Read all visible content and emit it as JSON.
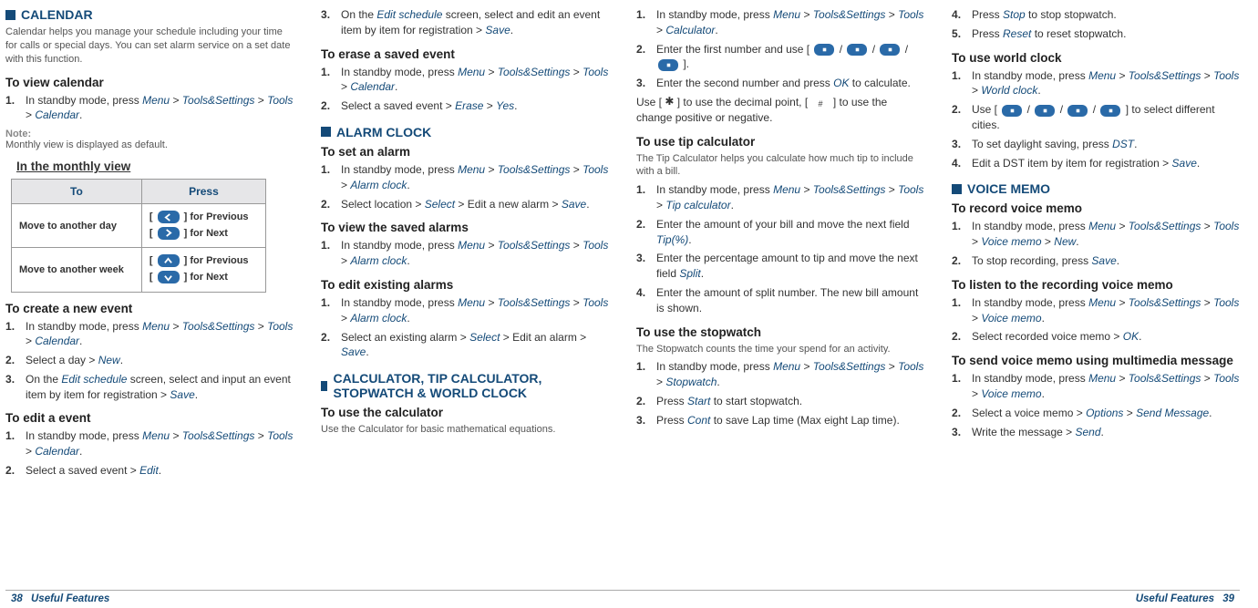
{
  "footer": {
    "leftPage": "38",
    "leftTitle": "Useful Features",
    "rightTitle": "Useful Features",
    "rightPage": "39"
  },
  "col1": {
    "calendar": {
      "title": "CALENDAR",
      "intro": "Calendar helps you manage your schedule including your time for calls or special days. You can set alarm service on a set date with this function.",
      "viewHead": "To view calendar",
      "viewStep": [
        "In standby mode, press ",
        "Menu",
        " > ",
        "Tools&Settings",
        " > ",
        "Tools",
        " > ",
        "Calendar",
        "."
      ],
      "noteLabel": "Note:",
      "noteBody": "Monthly view is displayed as default.",
      "monthlyHead": "In the monthly view",
      "tableHead": {
        "to": "To",
        "press": "Press"
      },
      "tableRows": [
        {
          "to": "Move to another day",
          "prev": " ] for Previous",
          "next": " ] for Next"
        },
        {
          "to": "Move to another week",
          "prev": " ] for Previous",
          "next": " ] for Next"
        }
      ],
      "createHead": "To create a new event",
      "createSteps": [
        [
          "In standby mode, press ",
          "Menu",
          " > ",
          "Tools&Settings",
          " > ",
          "Tools",
          " > ",
          "Calendar",
          "."
        ],
        [
          "Select a day > ",
          "New",
          "."
        ],
        [
          "On the ",
          "Edit schedule",
          " screen, select and input an event item by item for registration > ",
          "Save",
          "."
        ]
      ],
      "editHead": "To edit a event",
      "editSteps": [
        [
          "In standby mode, press ",
          "Menu",
          " > ",
          "Tools&Settings",
          " > ",
          "Tools",
          " > ",
          "Calendar",
          "."
        ],
        [
          "Select a saved event > ",
          "Edit",
          "."
        ]
      ]
    }
  },
  "col2": {
    "editCont": [
      "On the ",
      "Edit schedule",
      " screen, select and edit an event item by item for registration > ",
      "Save",
      "."
    ],
    "eraseHead": "To erase a saved event",
    "eraseSteps": [
      [
        "In standby mode, press ",
        "Menu",
        " > ",
        "Tools&Settings",
        " > ",
        "Tools",
        " > ",
        "Calendar",
        "."
      ],
      [
        "Select a saved event > ",
        "Erase",
        " > ",
        "Yes",
        "."
      ]
    ],
    "alarmTitle": "ALARM CLOCK",
    "setHead": "To set an alarm",
    "setSteps": [
      [
        "In standby mode, press ",
        "Menu",
        " > ",
        "Tools&Settings",
        " > ",
        "Tools",
        " > ",
        "Alarm clock",
        "."
      ],
      [
        "Select location > ",
        "Select",
        " > Edit a new alarm > ",
        "Save",
        "."
      ]
    ],
    "viewSavedHead": "To view the saved alarms",
    "viewSavedSteps": [
      [
        "In standby mode, press ",
        "Menu",
        " > ",
        "Tools&Settings",
        " > ",
        "Tools",
        " > ",
        "Alarm clock",
        "."
      ]
    ],
    "editExistHead": "To edit existing alarms",
    "editExistSteps": [
      [
        "In standby mode, press ",
        "Menu",
        " > ",
        "Tools&Settings",
        " > ",
        "Tools",
        " > ",
        "Alarm clock",
        "."
      ],
      [
        "Select an existing alarm > ",
        "Select",
        " > Edit an alarm > ",
        "Save",
        "."
      ]
    ],
    "calcTitle": "CALCULATOR, TIP CALCULATOR, STOPWATCH & WORLD CLOCK",
    "calcHead": "To use the calculator",
    "calcIntro": "Use the Calculator for basic mathematical equations."
  },
  "col3": {
    "calcSteps": [
      [
        "In standby mode, press ",
        "Menu",
        " > ",
        "Tools&Settings",
        " > ",
        "Tools",
        " > ",
        "Calculator",
        "."
      ],
      [
        "Enter the first number and use [ ",
        "ICON",
        " / ",
        "ICON",
        " / ",
        "ICON",
        " / ",
        "ICON",
        " ]."
      ],
      [
        "Enter the second number and press ",
        "OK",
        " to calculate."
      ]
    ],
    "useNote": [
      "Use [ ",
      "*",
      " ] to use the decimal point, [ ",
      "#",
      " ] to use the change positive or negative."
    ],
    "tipHead": "To use tip calculator",
    "tipIntro": "The Tip Calculator helps you calculate how much tip to include with a bill.",
    "tipSteps": [
      [
        "In standby mode, press ",
        "Menu",
        " > ",
        "Tools&Settings",
        " > ",
        "Tools",
        " > ",
        "Tip calculator",
        "."
      ],
      [
        "Enter the amount of your bill and move the next field ",
        "Tip(%)",
        "."
      ],
      [
        "Enter the percentage amount to tip and move the next field ",
        "Split",
        "."
      ],
      [
        "Enter the amount of split number. The new bill amount is shown."
      ]
    ],
    "stopHead": "To use the stopwatch",
    "stopIntro": "The Stopwatch counts the time your spend for an activity.",
    "stopSteps": [
      [
        "In standby mode, press ",
        "Menu",
        " > ",
        "Tools&Settings",
        " > ",
        "Tools",
        " > ",
        "Stopwatch",
        "."
      ],
      [
        "Press ",
        "Start",
        " to start stopwatch."
      ],
      [
        "Press ",
        "Cont",
        " to save Lap time (Max eight Lap time)."
      ]
    ]
  },
  "col4": {
    "stopCont": [
      [
        "Press ",
        "Stop",
        " to stop stopwatch."
      ],
      [
        "Press ",
        "Reset",
        " to reset stopwatch."
      ]
    ],
    "worldHead": "To use world clock",
    "worldSteps": [
      [
        "In standby mode, press ",
        "Menu",
        " > ",
        "Tools&Settings",
        " > ",
        "Tools",
        " > ",
        "World clock",
        "."
      ],
      [
        "Use [ ",
        "ICON",
        " / ",
        "ICON",
        " / ",
        "ICON",
        " / ",
        "ICON",
        " ] to select different cities."
      ],
      [
        "To set daylight saving, press ",
        "DST",
        "."
      ],
      [
        "Edit a DST item by item for registration > ",
        "Save",
        "."
      ]
    ],
    "voiceTitle": "VOICE MEMO",
    "recHead": "To record voice memo",
    "recSteps": [
      [
        "In standby mode, press ",
        "Menu",
        " > ",
        "Tools&Settings",
        " > ",
        "Tools",
        " > ",
        "Voice memo",
        " > ",
        "New",
        "."
      ],
      [
        "To stop recording, press ",
        "Save",
        "."
      ]
    ],
    "listenHead": "To listen to the recording voice memo",
    "listenSteps": [
      [
        "In standby mode, press ",
        "Menu",
        " > ",
        "Tools&Settings",
        " > ",
        "Tools",
        " > ",
        "Voice memo",
        "."
      ],
      [
        "Select recorded voice memo > ",
        "OK",
        "."
      ]
    ],
    "sendHead": "To send voice memo using multimedia message",
    "sendSteps": [
      [
        "In standby mode, press ",
        "Menu",
        " > ",
        "Tools&Settings",
        " > ",
        "Tools",
        " > ",
        "Voice memo",
        "."
      ],
      [
        "Select a voice memo > ",
        "Options",
        " > ",
        "Send Message",
        "."
      ],
      [
        "Write the message > ",
        "Send",
        "."
      ]
    ]
  }
}
